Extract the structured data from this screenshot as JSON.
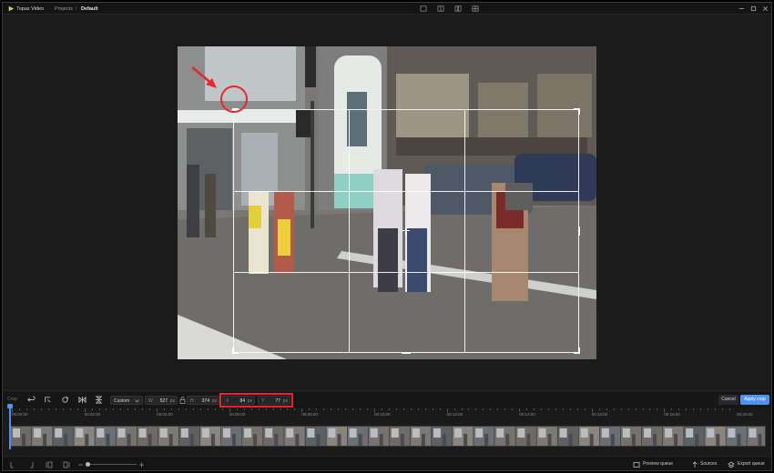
{
  "app": {
    "name": "Topaz Video",
    "breadcrumb": [
      "Projects",
      "Default"
    ],
    "separator": "/",
    "accent": "#4e93f3",
    "annotation_color": "#e8262d"
  },
  "controls": {
    "mode_label": "Crop",
    "preset": "Custom",
    "width": {
      "label": "W",
      "value": "527",
      "unit": "px"
    },
    "height": {
      "label": "H",
      "value": "374",
      "unit": "px"
    },
    "x": {
      "label": "X",
      "value": "84",
      "unit": "px"
    },
    "y": {
      "label": "Y",
      "value": "77",
      "unit": "px"
    },
    "cancel": "Cancel",
    "apply": "Apply crop"
  },
  "timeline": {
    "labels": [
      "00:00:00",
      "00:02:00",
      "00:04:00",
      "00:06:00",
      "00:08:00",
      "00:10:00",
      "00:12:00",
      "00:14:00",
      "00:16:00",
      "00:18:00",
      "00:20:00"
    ]
  },
  "footer": {
    "preview_queue": "Preview queue",
    "sources": "Sources",
    "export_queue": "Export queue"
  }
}
